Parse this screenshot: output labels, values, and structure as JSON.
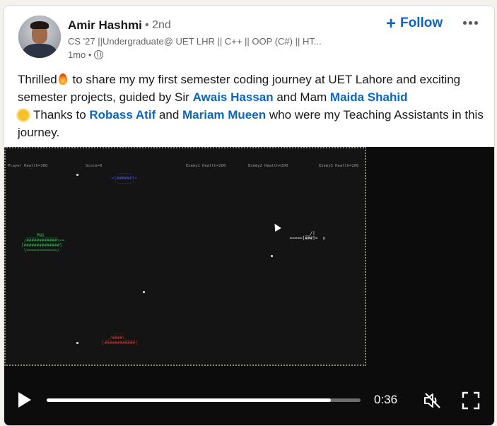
{
  "author": {
    "name": "Amir Hashmi",
    "degree": "• 2nd",
    "headline": "CS '27 ||Undergraduate@ UET LHR || C++ || OOP (C#) || HT...",
    "time": "1mo •"
  },
  "actions": {
    "follow_icon": "+",
    "follow_label": "Follow",
    "more_icon": "more-horizontal-icon"
  },
  "post": {
    "p1": "Thrilled",
    "p2": " to share my my first semester coding journey at UET Lahore and exciting semester projects, guided by Sir ",
    "mention1": "Awais Hassan",
    "p3": " and Mam ",
    "mention2": "Maida Shahid",
    "p4": "Thanks to ",
    "mention3": "Robass Atif",
    "p5": " and ",
    "mention4": "Mariam Mueen",
    "p6": " who were my Teaching Assistants in this journey."
  },
  "game": {
    "player_health": "Player Health=300",
    "score": "Score=0",
    "enemy1": "Enemy1 Health=200",
    "enemy2": "Enemy2 Health=200",
    "enemy3": "Enemy3 Health=200",
    "player_tag": "PNG",
    "colors": {
      "player": "#2db34a",
      "enemy_blue": "#3f4fd6",
      "enemy_red": "#d23434",
      "enemy_white": "#e6e6e6",
      "border": "#8b8a70"
    }
  },
  "video": {
    "time": "0:36",
    "progress_fraction": 0.905,
    "play_icon": "play-icon",
    "mute_icon": "volume-muted-icon",
    "fullscreen_icon": "fullscreen-icon"
  },
  "colors": {
    "link": "#0a66c2",
    "text": "#191919",
    "muted": "#666666"
  }
}
